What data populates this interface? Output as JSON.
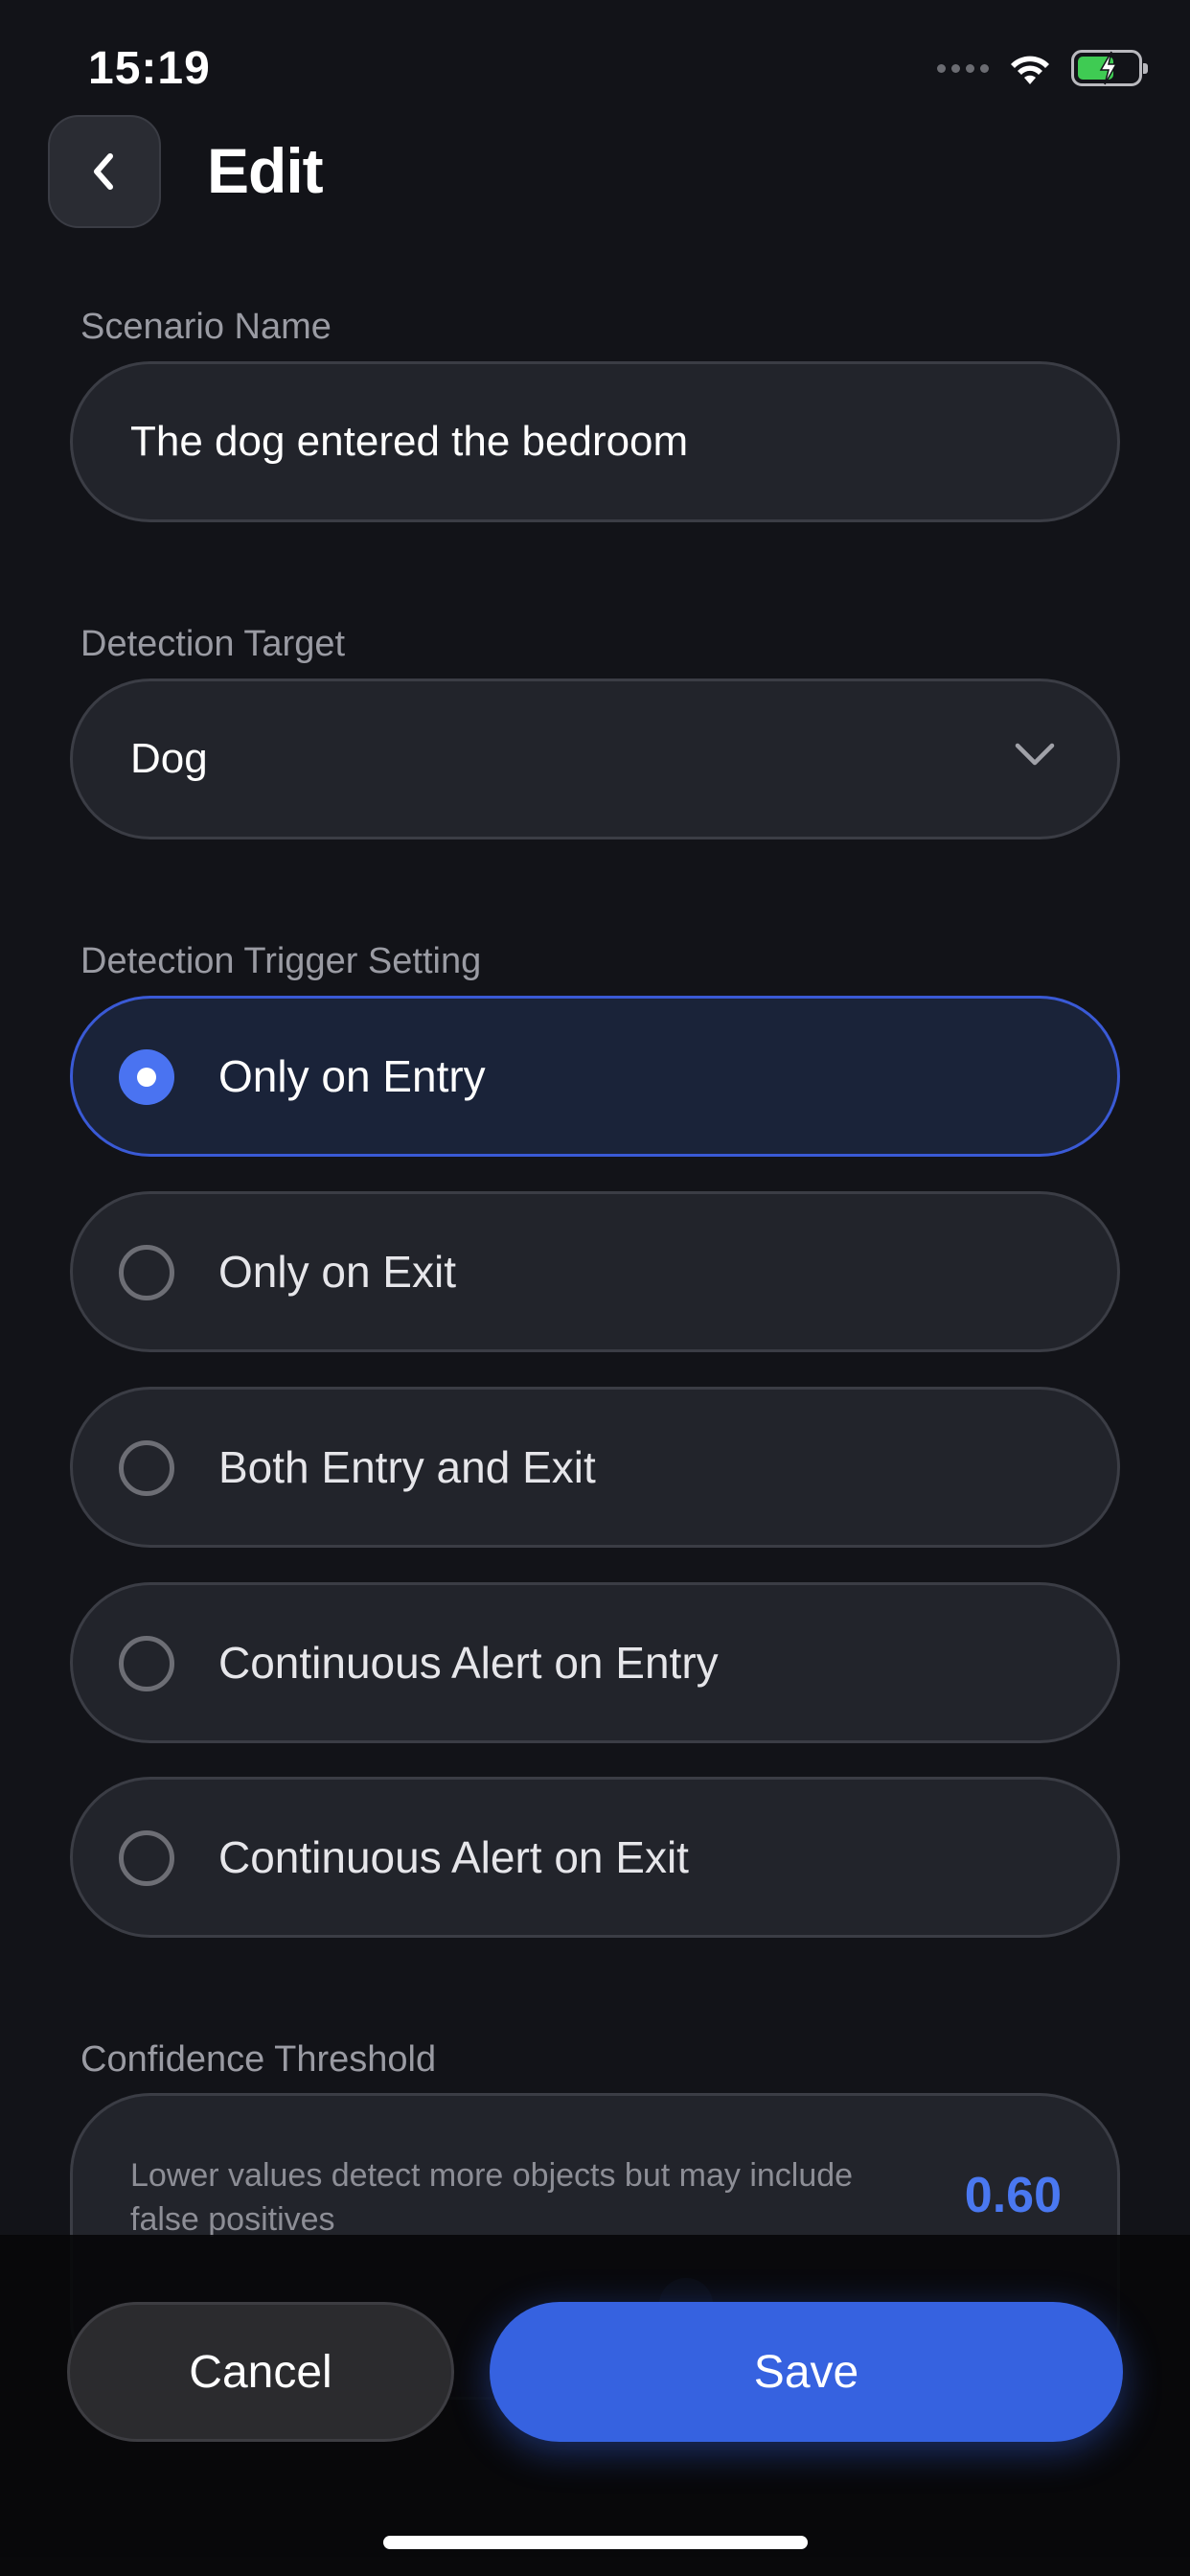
{
  "status_bar": {
    "time": "15:19"
  },
  "header": {
    "title": "Edit",
    "back_icon": "chevron-left-icon"
  },
  "scenario_name": {
    "label": "Scenario Name",
    "value": "The dog entered the bedroom"
  },
  "detection_target": {
    "label": "Detection Target",
    "value": "Dog",
    "icon": "chevron-down-icon"
  },
  "trigger_setting": {
    "label": "Detection Trigger Setting",
    "selected_index": 0,
    "options": [
      {
        "label": "Only on Entry",
        "selected": true
      },
      {
        "label": "Only on Exit",
        "selected": false
      },
      {
        "label": "Both Entry and Exit",
        "selected": false
      },
      {
        "label": "Continuous Alert on Entry",
        "selected": false
      },
      {
        "label": "Continuous Alert on Exit",
        "selected": false
      }
    ]
  },
  "confidence": {
    "label": "Confidence Threshold",
    "description": "Lower values detect more objects but may include false positives",
    "value": "0.60"
  },
  "actions": {
    "cancel_label": "Cancel",
    "save_label": "Save"
  },
  "colors": {
    "background": "#121318",
    "accent": "#3662e0",
    "selected_border": "#3a5ad6",
    "value_text": "#4a78f0"
  }
}
